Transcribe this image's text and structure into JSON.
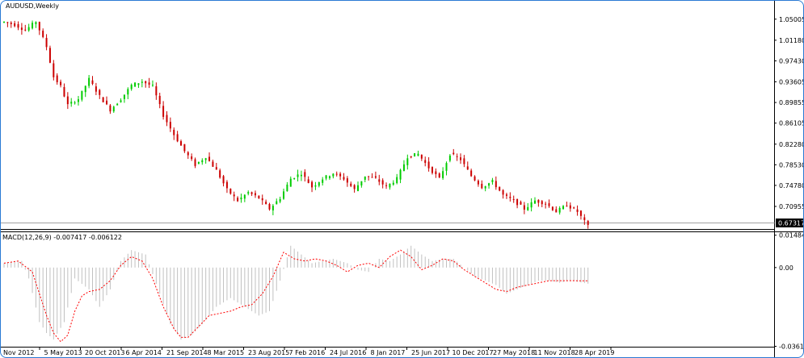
{
  "colors": {
    "bull": "#00cc00",
    "bear": "#cc0000",
    "signal": "#ff0000",
    "hist": "#c0c0c0",
    "frame": "#2a7ad4"
  },
  "main_title": "AUDUSD,Weekly",
  "indicator_title": "MACD(12,26,9) -0.007417 -0.006122",
  "chart_data": [
    {
      "type": "candlestick",
      "title": "AUDUSD,Weekly",
      "price_ticks": [
        "1.05005",
        "1.01180",
        "0.97430",
        "0.93605",
        "0.89855",
        "0.86105",
        "0.82280",
        "0.78530",
        "0.74780",
        "0.70955"
      ],
      "current_price": "0.67317",
      "ylim": [
        0.6685,
        1.0615
      ],
      "x_labels": [
        "Nov 2012",
        "5 May 2013",
        "20 Oct 2013",
        "6 Apr 2014",
        "21 Sep 2014",
        "8 Mar 2015",
        "23 Aug 2015",
        "7 Feb 2016",
        "24 Jul 2016",
        "8 Jan 2017",
        "25 Jun 2017",
        "10 Dec 2017",
        "27 May 2018",
        "11 Nov 2018",
        "28 Apr 2019"
      ],
      "close_path": [
        [
          0,
          1.045
        ],
        [
          3,
          1.04
        ],
        [
          6,
          1.03
        ],
        [
          9,
          1.046
        ],
        [
          12,
          1.0
        ],
        [
          14,
          0.945
        ],
        [
          16,
          0.928
        ],
        [
          18,
          0.894
        ],
        [
          21,
          0.905
        ],
        [
          24,
          0.941
        ],
        [
          27,
          0.91
        ],
        [
          30,
          0.885
        ],
        [
          33,
          0.905
        ],
        [
          36,
          0.93
        ],
        [
          39,
          0.937
        ],
        [
          42,
          0.928
        ],
        [
          45,
          0.875
        ],
        [
          48,
          0.84
        ],
        [
          51,
          0.81
        ],
        [
          54,
          0.785
        ],
        [
          57,
          0.8
        ],
        [
          60,
          0.775
        ],
        [
          63,
          0.74
        ],
        [
          66,
          0.72
        ],
        [
          69,
          0.735
        ],
        [
          72,
          0.725
        ],
        [
          75,
          0.705
        ],
        [
          78,
          0.725
        ],
        [
          81,
          0.76
        ],
        [
          84,
          0.77
        ],
        [
          87,
          0.745
        ],
        [
          90,
          0.76
        ],
        [
          93,
          0.77
        ],
        [
          96,
          0.76
        ],
        [
          99,
          0.74
        ],
        [
          102,
          0.765
        ],
        [
          105,
          0.76
        ],
        [
          108,
          0.745
        ],
        [
          111,
          0.76
        ],
        [
          114,
          0.8
        ],
        [
          117,
          0.805
        ],
        [
          120,
          0.78
        ],
        [
          123,
          0.76
        ],
        [
          126,
          0.805
        ],
        [
          129,
          0.795
        ],
        [
          132,
          0.765
        ],
        [
          135,
          0.745
        ],
        [
          138,
          0.755
        ],
        [
          141,
          0.73
        ],
        [
          144,
          0.72
        ],
        [
          147,
          0.705
        ],
        [
          150,
          0.72
        ],
        [
          153,
          0.715
        ],
        [
          156,
          0.7
        ],
        [
          159,
          0.712
        ],
        [
          162,
          0.7
        ],
        [
          165,
          0.6732
        ]
      ]
    },
    {
      "type": "macd",
      "title": "MACD(12,26,9)",
      "values_shown": [
        "-0.007417",
        "-0.006122"
      ],
      "y_ticks": [
        "0.014847",
        "0.00",
        "-0.036122"
      ],
      "ylim": [
        -0.0363,
        0.0151
      ],
      "histogram": [
        [
          0,
          0.002
        ],
        [
          5,
          0.003
        ],
        [
          7,
          -0.005
        ],
        [
          10,
          -0.025
        ],
        [
          12,
          -0.03
        ],
        [
          14,
          -0.033
        ],
        [
          17,
          -0.025
        ],
        [
          20,
          -0.005
        ],
        [
          24,
          -0.01
        ],
        [
          27,
          -0.018
        ],
        [
          30,
          -0.01
        ],
        [
          33,
          0.003
        ],
        [
          36,
          0.008
        ],
        [
          40,
          0.006
        ],
        [
          44,
          -0.012
        ],
        [
          47,
          -0.026
        ],
        [
          50,
          -0.033
        ],
        [
          53,
          -0.031
        ],
        [
          56,
          -0.026
        ],
        [
          60,
          -0.018
        ],
        [
          64,
          -0.014
        ],
        [
          68,
          -0.018
        ],
        [
          72,
          -0.022
        ],
        [
          75,
          -0.02
        ],
        [
          78,
          -0.006
        ],
        [
          81,
          0.01
        ],
        [
          84,
          0.006
        ],
        [
          87,
          0.002
        ],
        [
          90,
          0.003
        ],
        [
          93,
          0.004
        ],
        [
          97,
          0.002
        ],
        [
          100,
          -0.001
        ],
        [
          103,
          -0.002
        ],
        [
          106,
          0.004
        ],
        [
          109,
          0.003
        ],
        [
          112,
          0.006
        ],
        [
          115,
          0.01
        ],
        [
          118,
          0.006
        ],
        [
          121,
          0.003
        ],
        [
          124,
          0.004
        ],
        [
          127,
          0.004
        ],
        [
          130,
          0.0
        ],
        [
          133,
          -0.004
        ],
        [
          136,
          -0.006
        ],
        [
          139,
          -0.008
        ],
        [
          142,
          -0.012
        ],
        [
          145,
          -0.01
        ],
        [
          148,
          -0.008
        ],
        [
          151,
          -0.006
        ],
        [
          154,
          -0.006
        ],
        [
          157,
          -0.007
        ],
        [
          160,
          -0.006
        ],
        [
          165,
          -0.0074
        ]
      ],
      "signal": [
        [
          0,
          0.002
        ],
        [
          4,
          0.003
        ],
        [
          8,
          -0.002
        ],
        [
          10,
          -0.012
        ],
        [
          12,
          -0.022
        ],
        [
          14,
          -0.03
        ],
        [
          16,
          -0.034
        ],
        [
          18,
          -0.031
        ],
        [
          20,
          -0.02
        ],
        [
          22,
          -0.013
        ],
        [
          24,
          -0.011
        ],
        [
          27,
          -0.01
        ],
        [
          30,
          -0.006
        ],
        [
          33,
          0.001
        ],
        [
          36,
          0.005
        ],
        [
          39,
          0.003
        ],
        [
          42,
          -0.005
        ],
        [
          45,
          -0.018
        ],
        [
          48,
          -0.028
        ],
        [
          50,
          -0.032
        ],
        [
          52,
          -0.032
        ],
        [
          55,
          -0.027
        ],
        [
          58,
          -0.022
        ],
        [
          61,
          -0.021
        ],
        [
          64,
          -0.02
        ],
        [
          67,
          -0.018
        ],
        [
          70,
          -0.017
        ],
        [
          73,
          -0.012
        ],
        [
          76,
          -0.004
        ],
        [
          79,
          0.007
        ],
        [
          82,
          0.004
        ],
        [
          85,
          0.003
        ],
        [
          88,
          0.004
        ],
        [
          91,
          0.003
        ],
        [
          94,
          0.001
        ],
        [
          97,
          -0.002
        ],
        [
          100,
          0.001
        ],
        [
          103,
          0.002
        ],
        [
          106,
          0.0
        ],
        [
          109,
          0.005
        ],
        [
          112,
          0.008
        ],
        [
          115,
          0.005
        ],
        [
          118,
          -0.001
        ],
        [
          121,
          0.001
        ],
        [
          124,
          0.004
        ],
        [
          127,
          0.003
        ],
        [
          130,
          -0.001
        ],
        [
          133,
          -0.004
        ],
        [
          136,
          -0.007
        ],
        [
          139,
          -0.01
        ],
        [
          142,
          -0.011
        ],
        [
          145,
          -0.009
        ],
        [
          148,
          -0.008
        ],
        [
          151,
          -0.007
        ],
        [
          154,
          -0.006
        ],
        [
          157,
          -0.006
        ],
        [
          160,
          -0.006
        ],
        [
          165,
          -0.0061
        ]
      ]
    }
  ]
}
